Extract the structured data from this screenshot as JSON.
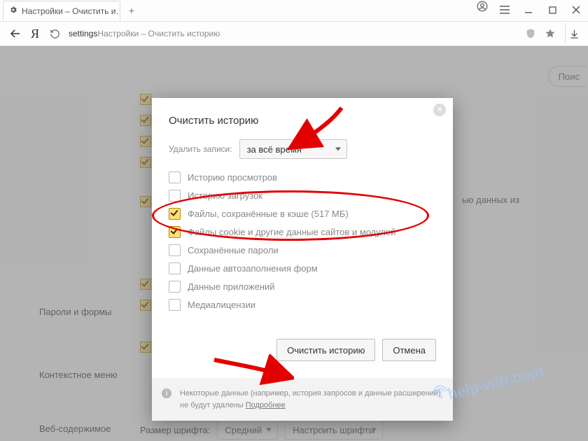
{
  "tab": {
    "title": "Настройки – Очистить и…"
  },
  "address": {
    "prefix": "settings",
    "rest": " Настройки – Очистить историю"
  },
  "search_pill": "Поис",
  "sections": {
    "passwords": "Пароли и формы",
    "context": "Контекстное меню",
    "webcontent": "Веб-содержимое",
    "fontsize_label": "Размер шрифта:",
    "fontsize_value": "Средний",
    "fonts_btn": "Настроить шрифты"
  },
  "bg_text_right": "ью данных из",
  "modal": {
    "title": "Очистить историю",
    "delete_label": "Удалить записи:",
    "range": "за всё время",
    "items": [
      {
        "label": "Историю просмотров",
        "checked": false
      },
      {
        "label": "Историю загрузок",
        "checked": false
      },
      {
        "label": "Файлы, сохранённые в кэше (517 МБ)",
        "checked": true
      },
      {
        "label": "Файлы cookie и другие данные сайтов и модулей",
        "checked": true
      },
      {
        "label": "Сохранённые пароли",
        "checked": false
      },
      {
        "label": "Данные автозаполнения форм",
        "checked": false
      },
      {
        "label": "Данные приложений",
        "checked": false
      },
      {
        "label": "Медиалицензии",
        "checked": false
      }
    ],
    "clear_btn": "Очистить историю",
    "cancel_btn": "Отмена",
    "note": "Некоторые данные (например, история запросов и данные расширений) не будут удалены ",
    "note_link": "Подробнее"
  },
  "watermark": "help-wifi.com"
}
